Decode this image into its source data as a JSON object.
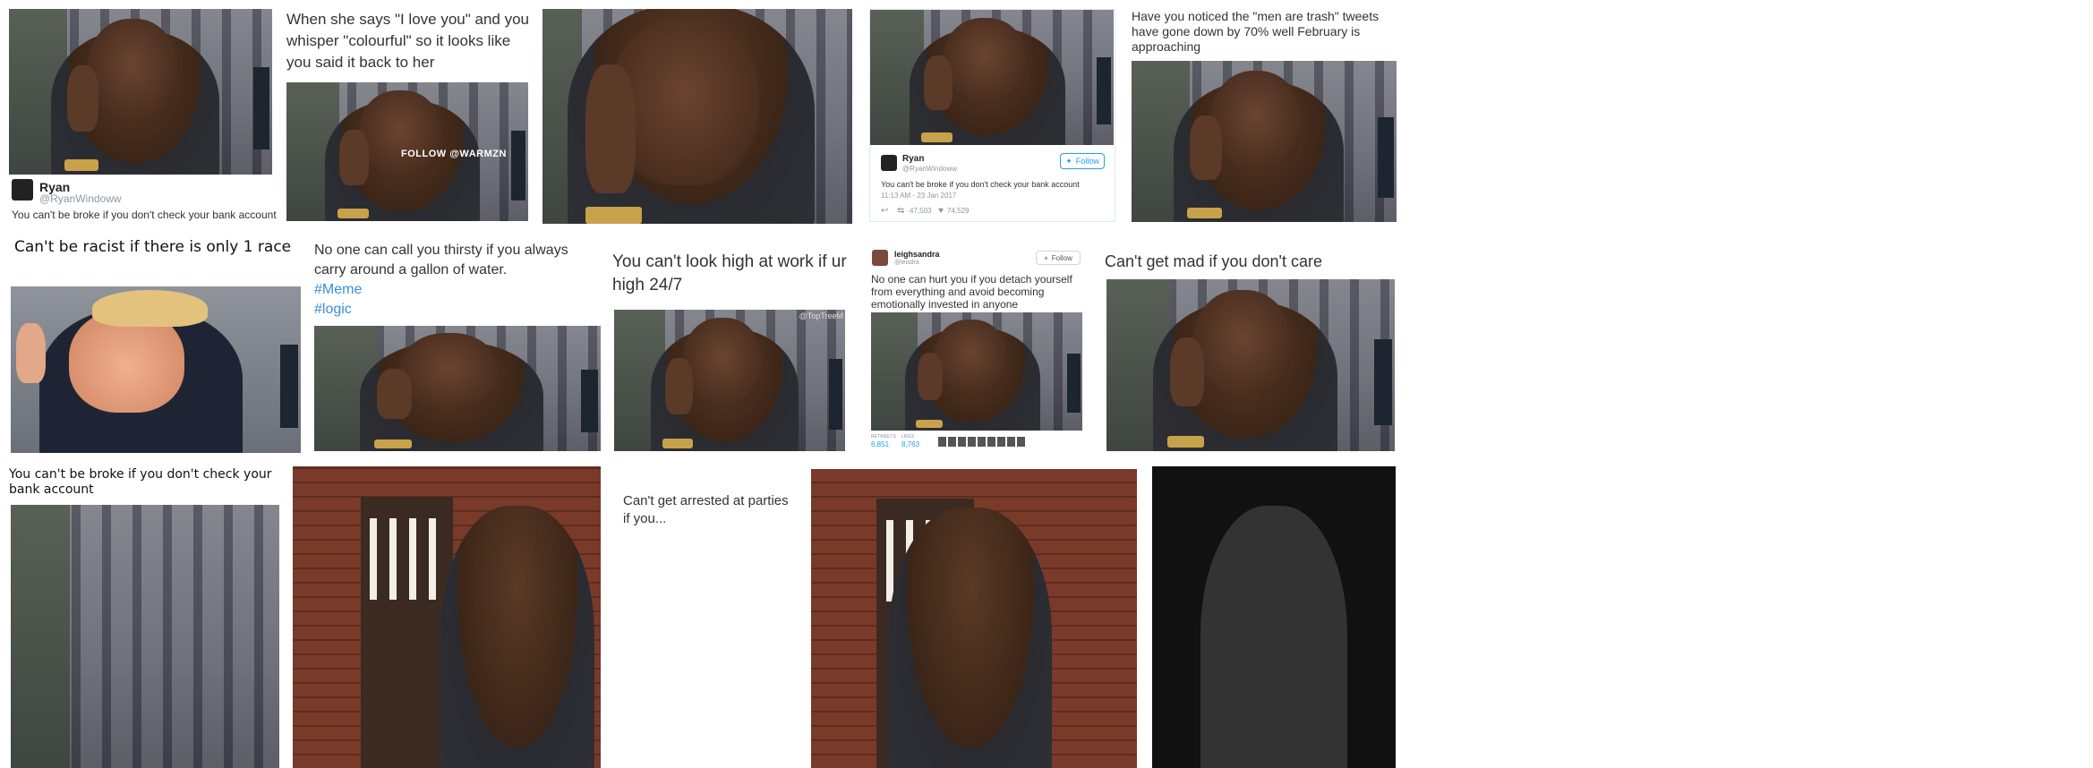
{
  "tiles": {
    "t1": {
      "name": "Ryan",
      "handle": "@RyanWindoww",
      "text": "You can't be broke if you don't check your bank account"
    },
    "t2": {
      "caption": "When she says \"I love you\" and you whisper \"colourful\" so it looks like you said it back to her",
      "watermark": "FOLLOW @WARMZN"
    },
    "t4": {
      "name": "Ryan",
      "handle": "@RyanWindoww",
      "follow": "Follow",
      "text": "You can't be broke if you don't check your bank account",
      "time": "11:13 AM - 23 Jan 2017",
      "retweets": "47,503",
      "likes": "74,529"
    },
    "t5": {
      "caption": "Have you noticed the \"men are trash\" tweets have gone down by 70% well February is approaching"
    },
    "t6": {
      "caption": "Can't be racist if there is only 1 race"
    },
    "t7": {
      "line1": "No one can call you thirsty if you always",
      "line2": "carry around a gallon of water.",
      "tag1": "#Meme",
      "tag2": "#logic"
    },
    "t8": {
      "caption": "You can't look high at work if ur high 24/7",
      "watermark": "@TopTreeM"
    },
    "t9": {
      "name": "leighsandra",
      "handle": "@leisdra",
      "follow": "Follow",
      "text": "No one can hurt you if you detach yourself from everything and avoid becoming emotionally invested in anyone",
      "retweets_label": "RETWEETS",
      "retweets": "6,851",
      "likes_label": "LIKES",
      "likes": "8,763"
    },
    "t10": {
      "caption": "Can't get mad if you don't care"
    },
    "t11": {
      "caption": "You can't be broke if you don't check your bank account"
    },
    "t13": {
      "caption": "Can't get arrested at parties if you..."
    }
  },
  "icons": {
    "reply": "reply-icon",
    "retweet": "retweet-icon",
    "like": "heart-icon",
    "twitter": "twitter-bird-icon",
    "follow": "add-user-icon"
  }
}
